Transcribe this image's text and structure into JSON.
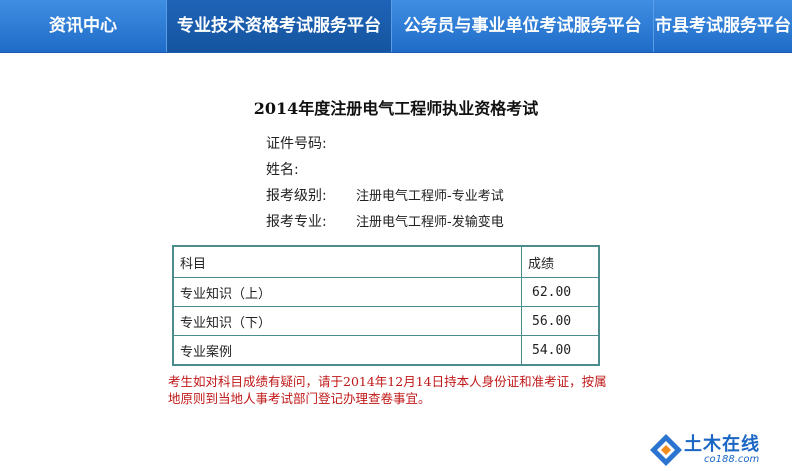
{
  "nav": {
    "items": [
      {
        "label": "资讯中心"
      },
      {
        "label": "专业技术资格考试服务平台"
      },
      {
        "label": "公务员与事业单位考试服务平台"
      },
      {
        "label": "市县考试服务平台"
      }
    ],
    "active_index": 1
  },
  "exam": {
    "title": "2014年度注册电气工程师执业资格考试",
    "fields": {
      "id_label": "证件号码:",
      "id_value": "",
      "name_label": "姓名:",
      "name_value": "",
      "level_label": "报考级别:",
      "level_value": "注册电气工程师-专业考试",
      "major_label": "报考专业:",
      "major_value": "注册电气工程师-发输变电"
    }
  },
  "scores": {
    "headers": {
      "subject": "科目",
      "score": "成绩"
    },
    "rows": [
      {
        "subject": "专业知识（上）",
        "score": "62.00"
      },
      {
        "subject": "专业知识（下）",
        "score": "56.00"
      },
      {
        "subject": "专业案例",
        "score": "54.00"
      }
    ]
  },
  "notice": "考生如对科目成绩有疑问，请于2014年12月14日持本人身份证和准考证，按属地原则到当地人事考试部门登记办理查卷事宜。",
  "watermark": {
    "text": "土木在线",
    "subtext": "co188.com"
  },
  "colors": {
    "nav_bg": "#2a7ad6",
    "notice": "#c01818",
    "table_border": "#4b8c8c"
  }
}
